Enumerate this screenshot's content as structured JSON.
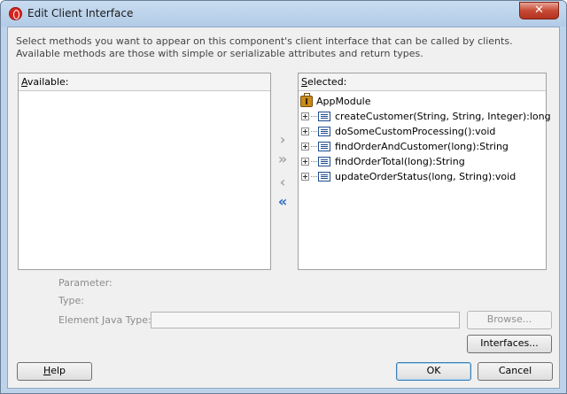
{
  "window": {
    "title": "Edit Client Interface",
    "close_glyph": "✕",
    "app_icon": "oracle-jdeveloper-icon"
  },
  "intro": {
    "text": "Select methods you want to appear on this component's client interface that can be called by clients.  Available methods are those with simple or serializable attributes and return types."
  },
  "available": {
    "label_mnemonic": "A",
    "label_rest": "vailable:",
    "items": []
  },
  "selected": {
    "label_mnemonic": "S",
    "label_rest": "elected:",
    "root": "AppModule",
    "methods": [
      "createCustomer(String, String, Integer):long",
      "doSomeCustomProcessing():void",
      "findOrderAndCustomer(long):String",
      "findOrderTotal(long):String",
      "updateOrderStatus(long, String):void"
    ]
  },
  "shuttle": {
    "add": "›",
    "add_all": "»",
    "remove": "‹",
    "remove_all": "«"
  },
  "details": {
    "parameter": "Parameter:",
    "type": "Type:",
    "element_java_type": "Element Java Type:",
    "element_java_type_value": ""
  },
  "buttons": {
    "browse": "Browse...",
    "interfaces": "Interfaces...",
    "help_mnemonic": "H",
    "help_rest": "elp",
    "ok": "OK",
    "cancel": "Cancel"
  }
}
